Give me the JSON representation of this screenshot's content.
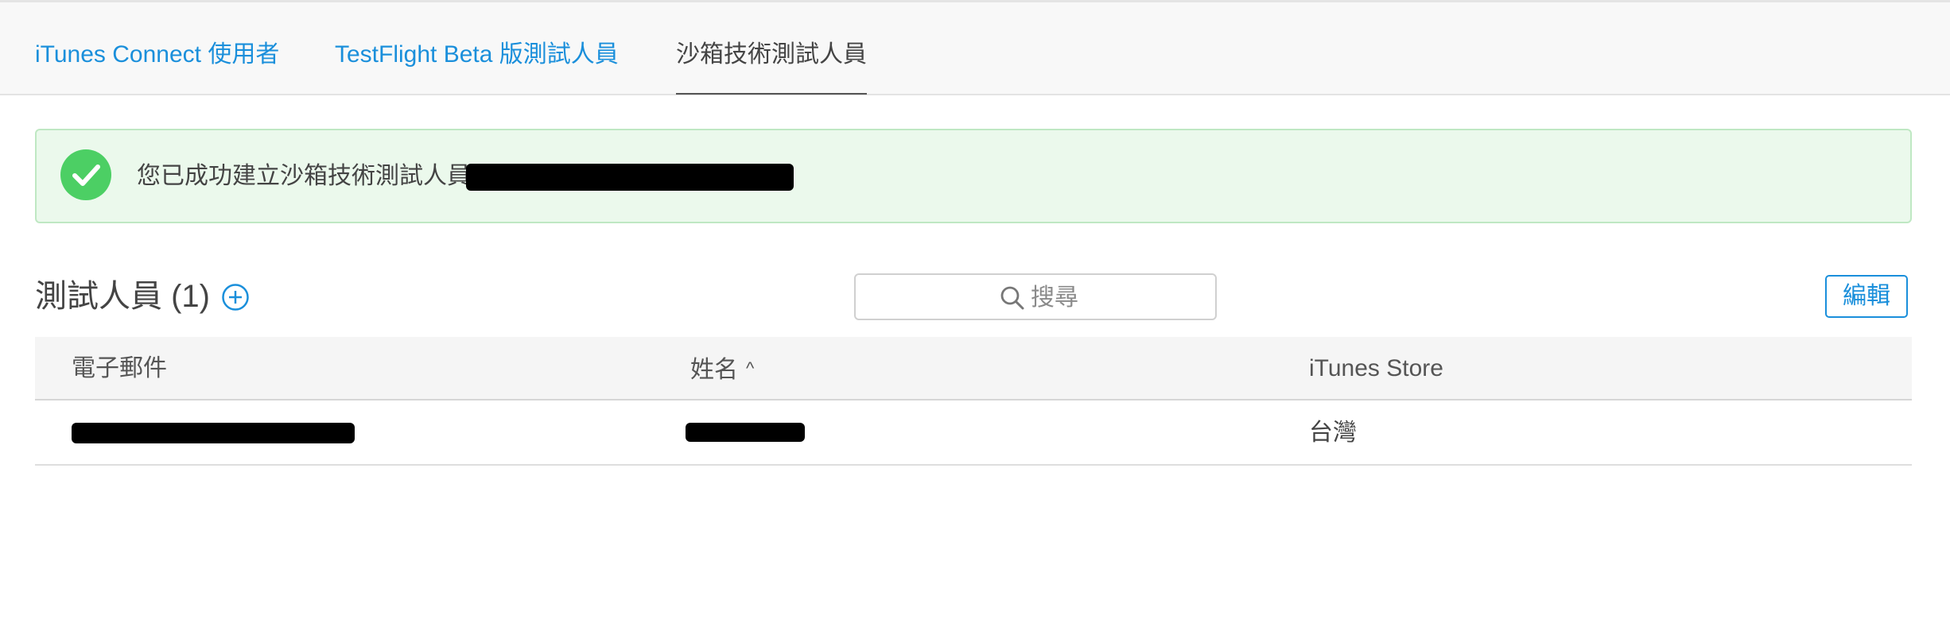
{
  "tabs": [
    {
      "label": "iTunes Connect 使用者",
      "active": false
    },
    {
      "label": "TestFlight Beta 版測試人員",
      "active": false
    },
    {
      "label": "沙箱技術測試人員",
      "active": true
    }
  ],
  "alert": {
    "message": "您已成功建立沙箱技術測試人員",
    "icon": "checkmark-circle-icon",
    "redacted_email": "[redacted]"
  },
  "testers": {
    "title": "測試人員 (1)",
    "add_icon": "plus-circle-icon"
  },
  "search": {
    "placeholder": "搜尋",
    "value": ""
  },
  "edit_label": "編輯",
  "table": {
    "columns": [
      "電子郵件",
      "姓名",
      "iTunes Store"
    ],
    "sorted_column": "姓名",
    "sort_direction": "ascending",
    "rows": [
      {
        "email": "[redacted]",
        "name": "[redacted]",
        "store": "台灣"
      }
    ]
  },
  "colors": {
    "accent": "#1a8fdb",
    "success": "#4ccf64",
    "alert_bg": "#ebf9ec"
  }
}
